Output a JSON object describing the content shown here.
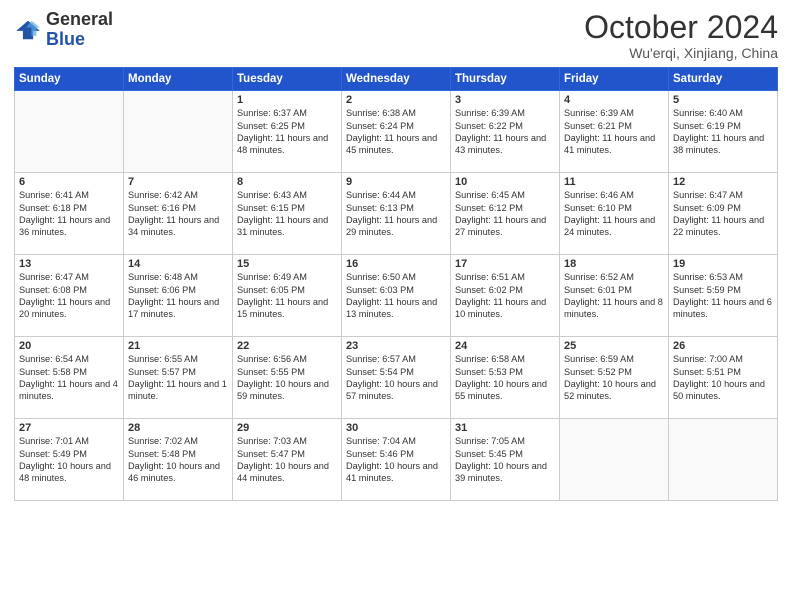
{
  "header": {
    "logo_general": "General",
    "logo_blue": "Blue",
    "month_title": "October 2024",
    "location": "Wu'erqi, Xinjiang, China"
  },
  "weekdays": [
    "Sunday",
    "Monday",
    "Tuesday",
    "Wednesday",
    "Thursday",
    "Friday",
    "Saturday"
  ],
  "weeks": [
    [
      {
        "day": "",
        "info": ""
      },
      {
        "day": "",
        "info": ""
      },
      {
        "day": "1",
        "info": "Sunrise: 6:37 AM\nSunset: 6:25 PM\nDaylight: 11 hours and 48 minutes."
      },
      {
        "day": "2",
        "info": "Sunrise: 6:38 AM\nSunset: 6:24 PM\nDaylight: 11 hours and 45 minutes."
      },
      {
        "day": "3",
        "info": "Sunrise: 6:39 AM\nSunset: 6:22 PM\nDaylight: 11 hours and 43 minutes."
      },
      {
        "day": "4",
        "info": "Sunrise: 6:39 AM\nSunset: 6:21 PM\nDaylight: 11 hours and 41 minutes."
      },
      {
        "day": "5",
        "info": "Sunrise: 6:40 AM\nSunset: 6:19 PM\nDaylight: 11 hours and 38 minutes."
      }
    ],
    [
      {
        "day": "6",
        "info": "Sunrise: 6:41 AM\nSunset: 6:18 PM\nDaylight: 11 hours and 36 minutes."
      },
      {
        "day": "7",
        "info": "Sunrise: 6:42 AM\nSunset: 6:16 PM\nDaylight: 11 hours and 34 minutes."
      },
      {
        "day": "8",
        "info": "Sunrise: 6:43 AM\nSunset: 6:15 PM\nDaylight: 11 hours and 31 minutes."
      },
      {
        "day": "9",
        "info": "Sunrise: 6:44 AM\nSunset: 6:13 PM\nDaylight: 11 hours and 29 minutes."
      },
      {
        "day": "10",
        "info": "Sunrise: 6:45 AM\nSunset: 6:12 PM\nDaylight: 11 hours and 27 minutes."
      },
      {
        "day": "11",
        "info": "Sunrise: 6:46 AM\nSunset: 6:10 PM\nDaylight: 11 hours and 24 minutes."
      },
      {
        "day": "12",
        "info": "Sunrise: 6:47 AM\nSunset: 6:09 PM\nDaylight: 11 hours and 22 minutes."
      }
    ],
    [
      {
        "day": "13",
        "info": "Sunrise: 6:47 AM\nSunset: 6:08 PM\nDaylight: 11 hours and 20 minutes."
      },
      {
        "day": "14",
        "info": "Sunrise: 6:48 AM\nSunset: 6:06 PM\nDaylight: 11 hours and 17 minutes."
      },
      {
        "day": "15",
        "info": "Sunrise: 6:49 AM\nSunset: 6:05 PM\nDaylight: 11 hours and 15 minutes."
      },
      {
        "day": "16",
        "info": "Sunrise: 6:50 AM\nSunset: 6:03 PM\nDaylight: 11 hours and 13 minutes."
      },
      {
        "day": "17",
        "info": "Sunrise: 6:51 AM\nSunset: 6:02 PM\nDaylight: 11 hours and 10 minutes."
      },
      {
        "day": "18",
        "info": "Sunrise: 6:52 AM\nSunset: 6:01 PM\nDaylight: 11 hours and 8 minutes."
      },
      {
        "day": "19",
        "info": "Sunrise: 6:53 AM\nSunset: 5:59 PM\nDaylight: 11 hours and 6 minutes."
      }
    ],
    [
      {
        "day": "20",
        "info": "Sunrise: 6:54 AM\nSunset: 5:58 PM\nDaylight: 11 hours and 4 minutes."
      },
      {
        "day": "21",
        "info": "Sunrise: 6:55 AM\nSunset: 5:57 PM\nDaylight: 11 hours and 1 minute."
      },
      {
        "day": "22",
        "info": "Sunrise: 6:56 AM\nSunset: 5:55 PM\nDaylight: 10 hours and 59 minutes."
      },
      {
        "day": "23",
        "info": "Sunrise: 6:57 AM\nSunset: 5:54 PM\nDaylight: 10 hours and 57 minutes."
      },
      {
        "day": "24",
        "info": "Sunrise: 6:58 AM\nSunset: 5:53 PM\nDaylight: 10 hours and 55 minutes."
      },
      {
        "day": "25",
        "info": "Sunrise: 6:59 AM\nSunset: 5:52 PM\nDaylight: 10 hours and 52 minutes."
      },
      {
        "day": "26",
        "info": "Sunrise: 7:00 AM\nSunset: 5:51 PM\nDaylight: 10 hours and 50 minutes."
      }
    ],
    [
      {
        "day": "27",
        "info": "Sunrise: 7:01 AM\nSunset: 5:49 PM\nDaylight: 10 hours and 48 minutes."
      },
      {
        "day": "28",
        "info": "Sunrise: 7:02 AM\nSunset: 5:48 PM\nDaylight: 10 hours and 46 minutes."
      },
      {
        "day": "29",
        "info": "Sunrise: 7:03 AM\nSunset: 5:47 PM\nDaylight: 10 hours and 44 minutes."
      },
      {
        "day": "30",
        "info": "Sunrise: 7:04 AM\nSunset: 5:46 PM\nDaylight: 10 hours and 41 minutes."
      },
      {
        "day": "31",
        "info": "Sunrise: 7:05 AM\nSunset: 5:45 PM\nDaylight: 10 hours and 39 minutes."
      },
      {
        "day": "",
        "info": ""
      },
      {
        "day": "",
        "info": ""
      }
    ]
  ]
}
